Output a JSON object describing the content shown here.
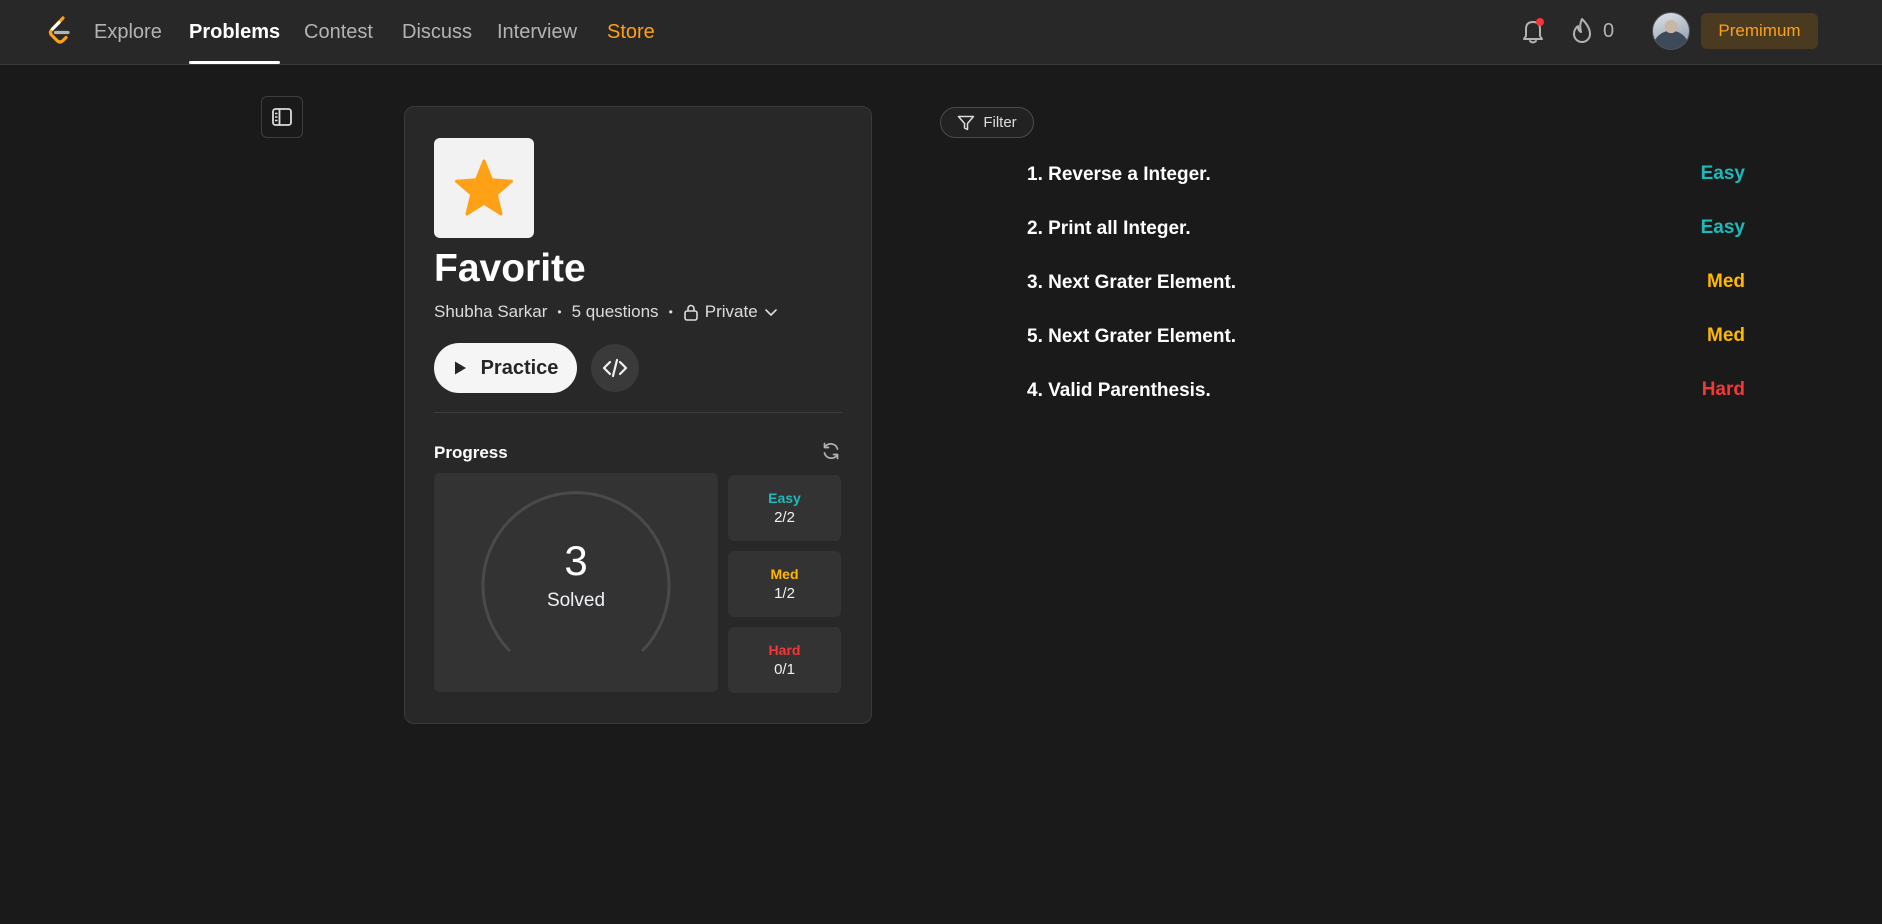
{
  "nav": {
    "items": [
      {
        "label": "Explore"
      },
      {
        "label": "Problems"
      },
      {
        "label": "Contest"
      },
      {
        "label": "Discuss"
      },
      {
        "label": "Interview"
      },
      {
        "label": "Store"
      }
    ],
    "active": "Problems",
    "streak_count": "0",
    "premium_label": "Premimum"
  },
  "list": {
    "title": "Favorite",
    "owner": "Shubha Sarkar",
    "question_count": "5 questions",
    "privacy": "Private",
    "practice_label": "Practice",
    "progress_label": "Progress",
    "solved_count": "3",
    "solved_label": "Solved",
    "breakdown": [
      {
        "name": "Easy",
        "count": "2/2"
      },
      {
        "name": "Med",
        "count": "1/2"
      },
      {
        "name": "Hard",
        "count": "0/1"
      }
    ]
  },
  "filter_label": "Filter",
  "problems": [
    {
      "title": "1. Reverse a Integer.",
      "difficulty": "Easy"
    },
    {
      "title": "2. Print all Integer.",
      "difficulty": "Easy"
    },
    {
      "title": "3. Next Grater Element.",
      "difficulty": "Med"
    },
    {
      "title": "5. Next Grater Element.",
      "difficulty": "Med"
    },
    {
      "title": "4. Valid Parenthesis.",
      "difficulty": "Hard"
    }
  ],
  "icons": {
    "logo": "leetcode-logo-icon",
    "notifications": "bell-icon",
    "streak": "fire-icon",
    "sidebar": "sidebar-toggle-icon",
    "cover": "star-icon",
    "privacy": "lock-icon",
    "privacy_menu": "chevron-down-icon",
    "practice": "play-icon",
    "code": "code-icon",
    "refresh": "refresh-icon",
    "filter": "filter-icon"
  },
  "colors": {
    "accent": "#ffa116",
    "easy": "#1cbaba",
    "med": "#ffb700",
    "hard": "#f63737",
    "background": "#1a1a1a",
    "surface": "#282828"
  }
}
